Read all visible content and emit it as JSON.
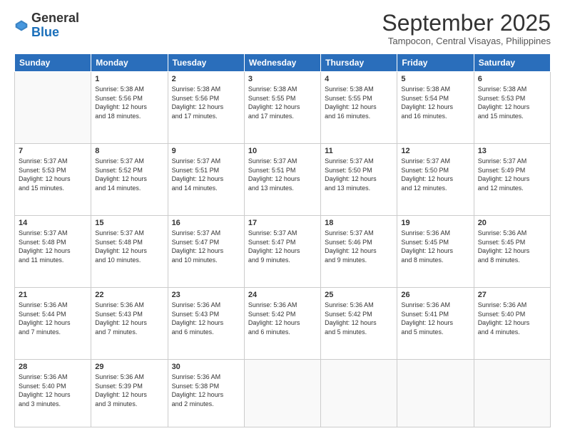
{
  "header": {
    "logo": {
      "general": "General",
      "blue": "Blue"
    },
    "title": "September 2025",
    "location": "Tampocon, Central Visayas, Philippines"
  },
  "weekdays": [
    "Sunday",
    "Monday",
    "Tuesday",
    "Wednesday",
    "Thursday",
    "Friday",
    "Saturday"
  ],
  "weeks": [
    [
      {
        "day": "",
        "data": ""
      },
      {
        "day": "1",
        "data": "Sunrise: 5:38 AM\nSunset: 5:56 PM\nDaylight: 12 hours\nand 18 minutes."
      },
      {
        "day": "2",
        "data": "Sunrise: 5:38 AM\nSunset: 5:56 PM\nDaylight: 12 hours\nand 17 minutes."
      },
      {
        "day": "3",
        "data": "Sunrise: 5:38 AM\nSunset: 5:55 PM\nDaylight: 12 hours\nand 17 minutes."
      },
      {
        "day": "4",
        "data": "Sunrise: 5:38 AM\nSunset: 5:55 PM\nDaylight: 12 hours\nand 16 minutes."
      },
      {
        "day": "5",
        "data": "Sunrise: 5:38 AM\nSunset: 5:54 PM\nDaylight: 12 hours\nand 16 minutes."
      },
      {
        "day": "6",
        "data": "Sunrise: 5:38 AM\nSunset: 5:53 PM\nDaylight: 12 hours\nand 15 minutes."
      }
    ],
    [
      {
        "day": "7",
        "data": "Sunrise: 5:37 AM\nSunset: 5:53 PM\nDaylight: 12 hours\nand 15 minutes."
      },
      {
        "day": "8",
        "data": "Sunrise: 5:37 AM\nSunset: 5:52 PM\nDaylight: 12 hours\nand 14 minutes."
      },
      {
        "day": "9",
        "data": "Sunrise: 5:37 AM\nSunset: 5:51 PM\nDaylight: 12 hours\nand 14 minutes."
      },
      {
        "day": "10",
        "data": "Sunrise: 5:37 AM\nSunset: 5:51 PM\nDaylight: 12 hours\nand 13 minutes."
      },
      {
        "day": "11",
        "data": "Sunrise: 5:37 AM\nSunset: 5:50 PM\nDaylight: 12 hours\nand 13 minutes."
      },
      {
        "day": "12",
        "data": "Sunrise: 5:37 AM\nSunset: 5:50 PM\nDaylight: 12 hours\nand 12 minutes."
      },
      {
        "day": "13",
        "data": "Sunrise: 5:37 AM\nSunset: 5:49 PM\nDaylight: 12 hours\nand 12 minutes."
      }
    ],
    [
      {
        "day": "14",
        "data": "Sunrise: 5:37 AM\nSunset: 5:48 PM\nDaylight: 12 hours\nand 11 minutes."
      },
      {
        "day": "15",
        "data": "Sunrise: 5:37 AM\nSunset: 5:48 PM\nDaylight: 12 hours\nand 10 minutes."
      },
      {
        "day": "16",
        "data": "Sunrise: 5:37 AM\nSunset: 5:47 PM\nDaylight: 12 hours\nand 10 minutes."
      },
      {
        "day": "17",
        "data": "Sunrise: 5:37 AM\nSunset: 5:47 PM\nDaylight: 12 hours\nand 9 minutes."
      },
      {
        "day": "18",
        "data": "Sunrise: 5:37 AM\nSunset: 5:46 PM\nDaylight: 12 hours\nand 9 minutes."
      },
      {
        "day": "19",
        "data": "Sunrise: 5:36 AM\nSunset: 5:45 PM\nDaylight: 12 hours\nand 8 minutes."
      },
      {
        "day": "20",
        "data": "Sunrise: 5:36 AM\nSunset: 5:45 PM\nDaylight: 12 hours\nand 8 minutes."
      }
    ],
    [
      {
        "day": "21",
        "data": "Sunrise: 5:36 AM\nSunset: 5:44 PM\nDaylight: 12 hours\nand 7 minutes."
      },
      {
        "day": "22",
        "data": "Sunrise: 5:36 AM\nSunset: 5:43 PM\nDaylight: 12 hours\nand 7 minutes."
      },
      {
        "day": "23",
        "data": "Sunrise: 5:36 AM\nSunset: 5:43 PM\nDaylight: 12 hours\nand 6 minutes."
      },
      {
        "day": "24",
        "data": "Sunrise: 5:36 AM\nSunset: 5:42 PM\nDaylight: 12 hours\nand 6 minutes."
      },
      {
        "day": "25",
        "data": "Sunrise: 5:36 AM\nSunset: 5:42 PM\nDaylight: 12 hours\nand 5 minutes."
      },
      {
        "day": "26",
        "data": "Sunrise: 5:36 AM\nSunset: 5:41 PM\nDaylight: 12 hours\nand 5 minutes."
      },
      {
        "day": "27",
        "data": "Sunrise: 5:36 AM\nSunset: 5:40 PM\nDaylight: 12 hours\nand 4 minutes."
      }
    ],
    [
      {
        "day": "28",
        "data": "Sunrise: 5:36 AM\nSunset: 5:40 PM\nDaylight: 12 hours\nand 3 minutes."
      },
      {
        "day": "29",
        "data": "Sunrise: 5:36 AM\nSunset: 5:39 PM\nDaylight: 12 hours\nand 3 minutes."
      },
      {
        "day": "30",
        "data": "Sunrise: 5:36 AM\nSunset: 5:38 PM\nDaylight: 12 hours\nand 2 minutes."
      },
      {
        "day": "",
        "data": ""
      },
      {
        "day": "",
        "data": ""
      },
      {
        "day": "",
        "data": ""
      },
      {
        "day": "",
        "data": ""
      }
    ]
  ]
}
